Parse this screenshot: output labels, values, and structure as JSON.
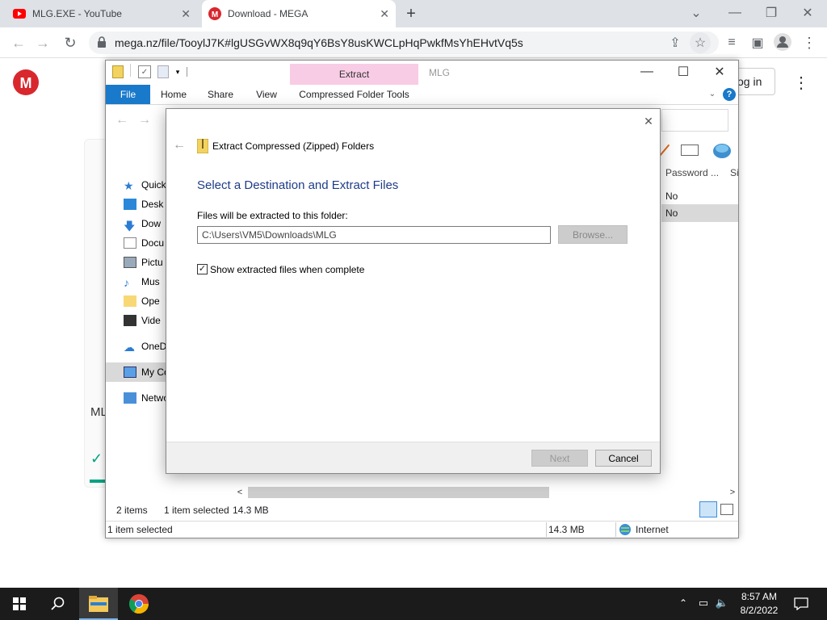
{
  "browser": {
    "tabs": [
      {
        "title": "MLG.EXE - YouTube"
      },
      {
        "title": "Download - MEGA"
      }
    ],
    "new_tab": "+",
    "url": "mega.nz/file/TooylJ7K#lgUSGvWX8q9qY6BsY8usKWCLpHqPwkfMsYhEHvtVq5s",
    "window_controls": {
      "min": "⌄",
      "restore": "—",
      "max": "❐",
      "close": "✕"
    }
  },
  "mega": {
    "logo": "M",
    "login_label": "og in",
    "file_label_partial": "ML",
    "check": "✓"
  },
  "explorer": {
    "ribbon_tabs": [
      "File",
      "Home",
      "Share",
      "View"
    ],
    "context_group": "Extract",
    "context_tab": "Compressed Folder Tools",
    "title": "MLG",
    "column_headers": [
      "Password ...",
      "Si"
    ],
    "rows": [
      {
        "password": "No"
      },
      {
        "password": "No"
      }
    ],
    "nav_items": [
      {
        "label": "Quick"
      },
      {
        "label": "Desk"
      },
      {
        "label": "Dow"
      },
      {
        "label": "Docu"
      },
      {
        "label": "Pictu"
      },
      {
        "label": "Mus"
      },
      {
        "label": "Ope"
      },
      {
        "label": "Vide"
      },
      {
        "label": "OneD"
      },
      {
        "label": "My Co"
      },
      {
        "label": "Netwo"
      }
    ],
    "status": {
      "items": "2 items",
      "selected": "1 item selected",
      "size": "14.3 MB"
    },
    "bottom_status": {
      "selected": "1 item selected",
      "size": "14.3 MB",
      "zone": "Internet"
    },
    "help": "?"
  },
  "dialog": {
    "title": "Extract Compressed (Zipped) Folders",
    "heading": "Select a Destination and Extract Files",
    "path_label": "Files will be extracted to this folder:",
    "path_value": "C:\\Users\\VM5\\Downloads\\MLG",
    "browse": "Browse...",
    "checkbox_label": "Show extracted files when complete",
    "checkbox_checked": true,
    "next": "Next",
    "cancel": "Cancel",
    "close": "✕",
    "back": "←"
  },
  "taskbar": {
    "time": "8:57 AM",
    "date": "8/2/2022"
  },
  "colors": {
    "ribbon_file": "#1979ca",
    "mega_red": "#d9272e",
    "context_pink": "#f9cce5",
    "heading_blue": "#1e3c87"
  }
}
